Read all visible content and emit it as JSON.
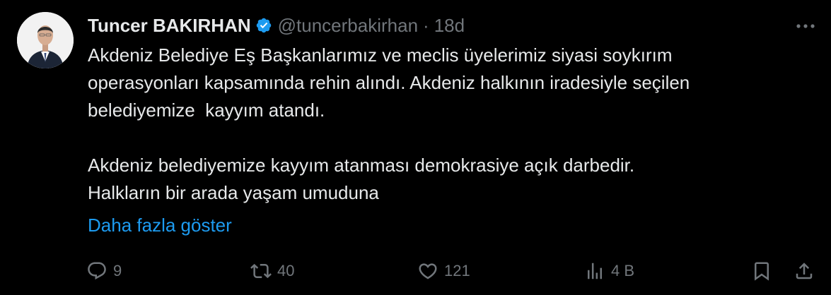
{
  "author": {
    "name": "Tuncer BAKIRHAN",
    "handle": "@tuncerbakirhan",
    "separator": "·",
    "time": "18d",
    "verified": true
  },
  "tweet": {
    "lines": [
      "Akdeniz Belediye Eş Başkanlarımız ve meclis üyelerimiz siyasi soykırım",
      "operasyonları kapsamında rehin alındı. Akdeniz halkının iradesiyle seçilen",
      "belediyemize  kayyım atandı."
    ],
    "lines2": [
      "Akdeniz belediyemize kayyım atanması demokrasiye açık darbedir.",
      "Halkların bir arada yaşam umuduna"
    ],
    "show_more": "Daha fazla göster"
  },
  "actions": {
    "replies": "9",
    "reposts": "40",
    "likes": "121",
    "views": "4 B"
  },
  "colors": {
    "background": "#000000",
    "text": "#e7e9ea",
    "secondary": "#71767b",
    "accent": "#1d9bf0"
  },
  "icons": {
    "verified": "verified-badge-icon",
    "more": "more-dots-icon",
    "reply": "reply-icon",
    "repost": "repost-icon",
    "like": "like-icon",
    "views": "views-icon",
    "bookmark": "bookmark-icon",
    "share": "share-icon"
  }
}
